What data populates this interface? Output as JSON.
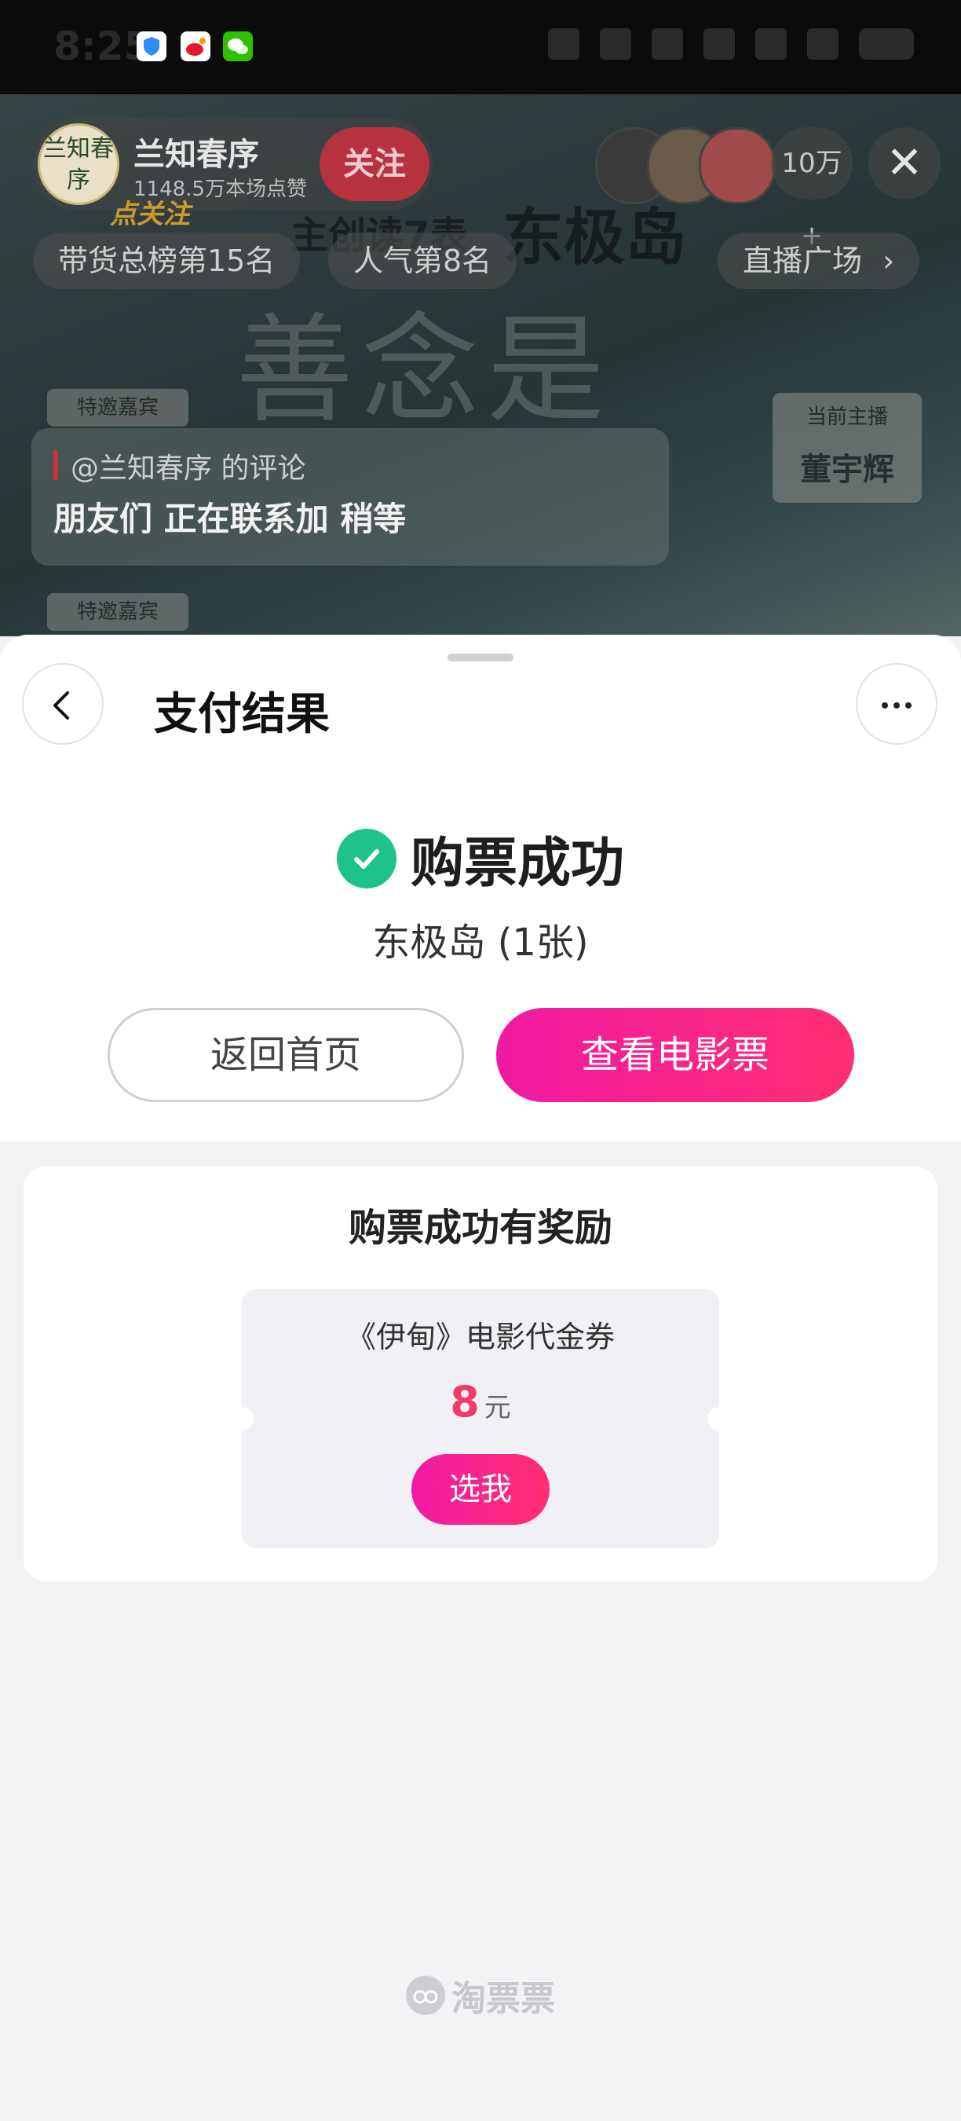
{
  "status_bar": {
    "time": "8:25"
  },
  "live_room": {
    "anchor": {
      "avatar_text": "兰知春序",
      "name": "兰知春序",
      "likes": "1148.5万本场点赞",
      "follow_label": "关注",
      "follow_badge": "点关注"
    },
    "viewer_count": "10万+",
    "chips": {
      "sales_rank": "带货总榜第15名",
      "popularity_rank": "人气第8名",
      "live_plaza": "直播广场"
    },
    "poster": {
      "title": "东极岛",
      "slogan": "善念是",
      "banner": "主创读7表",
      "guest_tag": "特邀嘉宾",
      "host_tag_label": "当前主播",
      "host_tag_name": "董宇辉"
    },
    "comment": {
      "author": "@兰知春序 的评论",
      "text": "朋友们 正在联系加 稍等"
    }
  },
  "sheet": {
    "title": "支付结果",
    "status": "购票成功",
    "movie_line": "东极岛 (1张)",
    "home_button": "返回首页",
    "view_ticket_button": "查看电影票",
    "reward": {
      "title": "购票成功有奖励",
      "coupon_name": "《伊甸》电影代金券",
      "amount": "8",
      "unit": "元",
      "pick_button": "选我"
    },
    "brand": "淘票票"
  },
  "colors": {
    "accent_start": "#f01aa3",
    "accent_end": "#ff2f72",
    "success_green": "#1ec28b",
    "amount_red": "#f03a6a"
  }
}
